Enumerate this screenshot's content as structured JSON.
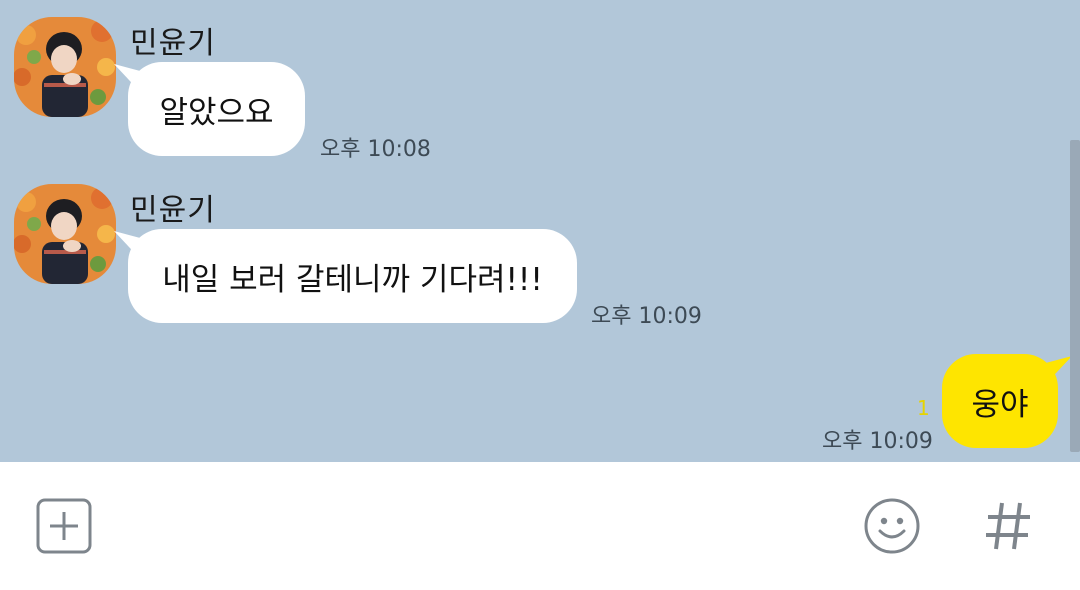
{
  "messages": [
    {
      "sender": "민윤기",
      "text": "알았으요",
      "time": "오후 10:08"
    },
    {
      "sender": "민윤기",
      "text": "내일 보러 갈테니까 기다려!!!",
      "time": "오후 10:09"
    },
    {
      "text": "웅야",
      "time": "오후 10:09",
      "unread": "1"
    }
  ],
  "colors": {
    "chat_background": "#b2c7d9",
    "incoming_bubble": "#ffffff",
    "outgoing_bubble": "#fee500",
    "unread_count": "#e6d400"
  },
  "input_bar": {
    "icons": [
      "plus-square-icon",
      "emoji-icon",
      "hashtag-icon"
    ]
  }
}
